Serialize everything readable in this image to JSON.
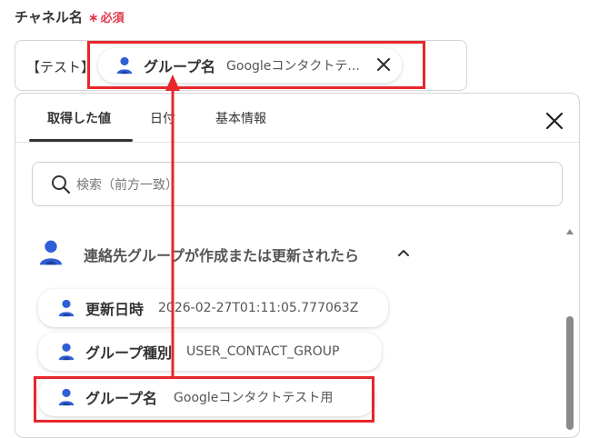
{
  "field": {
    "label": "チャネル名",
    "required_mark": "∗",
    "required_text": "必須",
    "prefix_text": "【テスト】",
    "chip": {
      "key": "グループ名",
      "value": "Googleコンタクトテ..."
    }
  },
  "tabs": [
    {
      "label": "取得した値",
      "active": true
    },
    {
      "label": "日付",
      "active": false
    },
    {
      "label": "基本情報",
      "active": false
    }
  ],
  "search": {
    "placeholder": "検索（前方一致）"
  },
  "group": {
    "title": "連絡先グループが作成または更新されたら",
    "items": [
      {
        "key": "更新日時",
        "value": "2026-02-27T01:11:05.777063Z"
      },
      {
        "key": "グループ種別",
        "value": "USER_CONTACT_GROUP"
      },
      {
        "key": "グループ名",
        "value": "Googleコンタクトテスト用"
      }
    ]
  },
  "colors": {
    "accent_required": "#e2384b",
    "highlight": "#e8262b",
    "person_icon": "#2f5fd6"
  },
  "icons": {
    "chip": "person-icon",
    "remove": "close-icon",
    "panel_close": "close-icon",
    "search": "search-icon",
    "group": "person-icon",
    "collapse": "chevron-up-icon"
  }
}
